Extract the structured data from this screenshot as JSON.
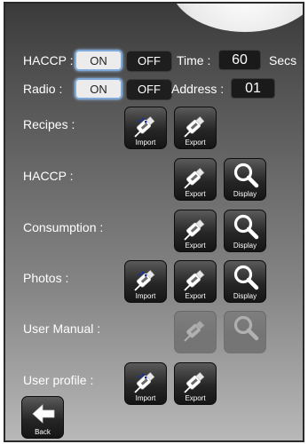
{
  "settings": {
    "haccp_label": "HACCP :",
    "radio_label": "Radio :",
    "on_label": "ON",
    "off_label": "OFF",
    "time_label": "Time :",
    "time_value": "60",
    "time_unit": "Secs",
    "address_label": "Address :",
    "address_value": "01"
  },
  "rows": {
    "recipes": "Recipes :",
    "haccp": "HACCP :",
    "consumption": "Consumption :",
    "photos": "Photos :",
    "user_manual": "User Manual :",
    "user_profile": "User profile :"
  },
  "buttons": {
    "import": "Import",
    "export": "Export",
    "display": "Display",
    "back": "Back"
  },
  "colors": {
    "active_border": "#7fa9d9"
  },
  "icons": {
    "import": "usb-import-icon",
    "export": "usb-export-icon",
    "display": "magnifier-icon",
    "back": "arrow-left-icon"
  }
}
